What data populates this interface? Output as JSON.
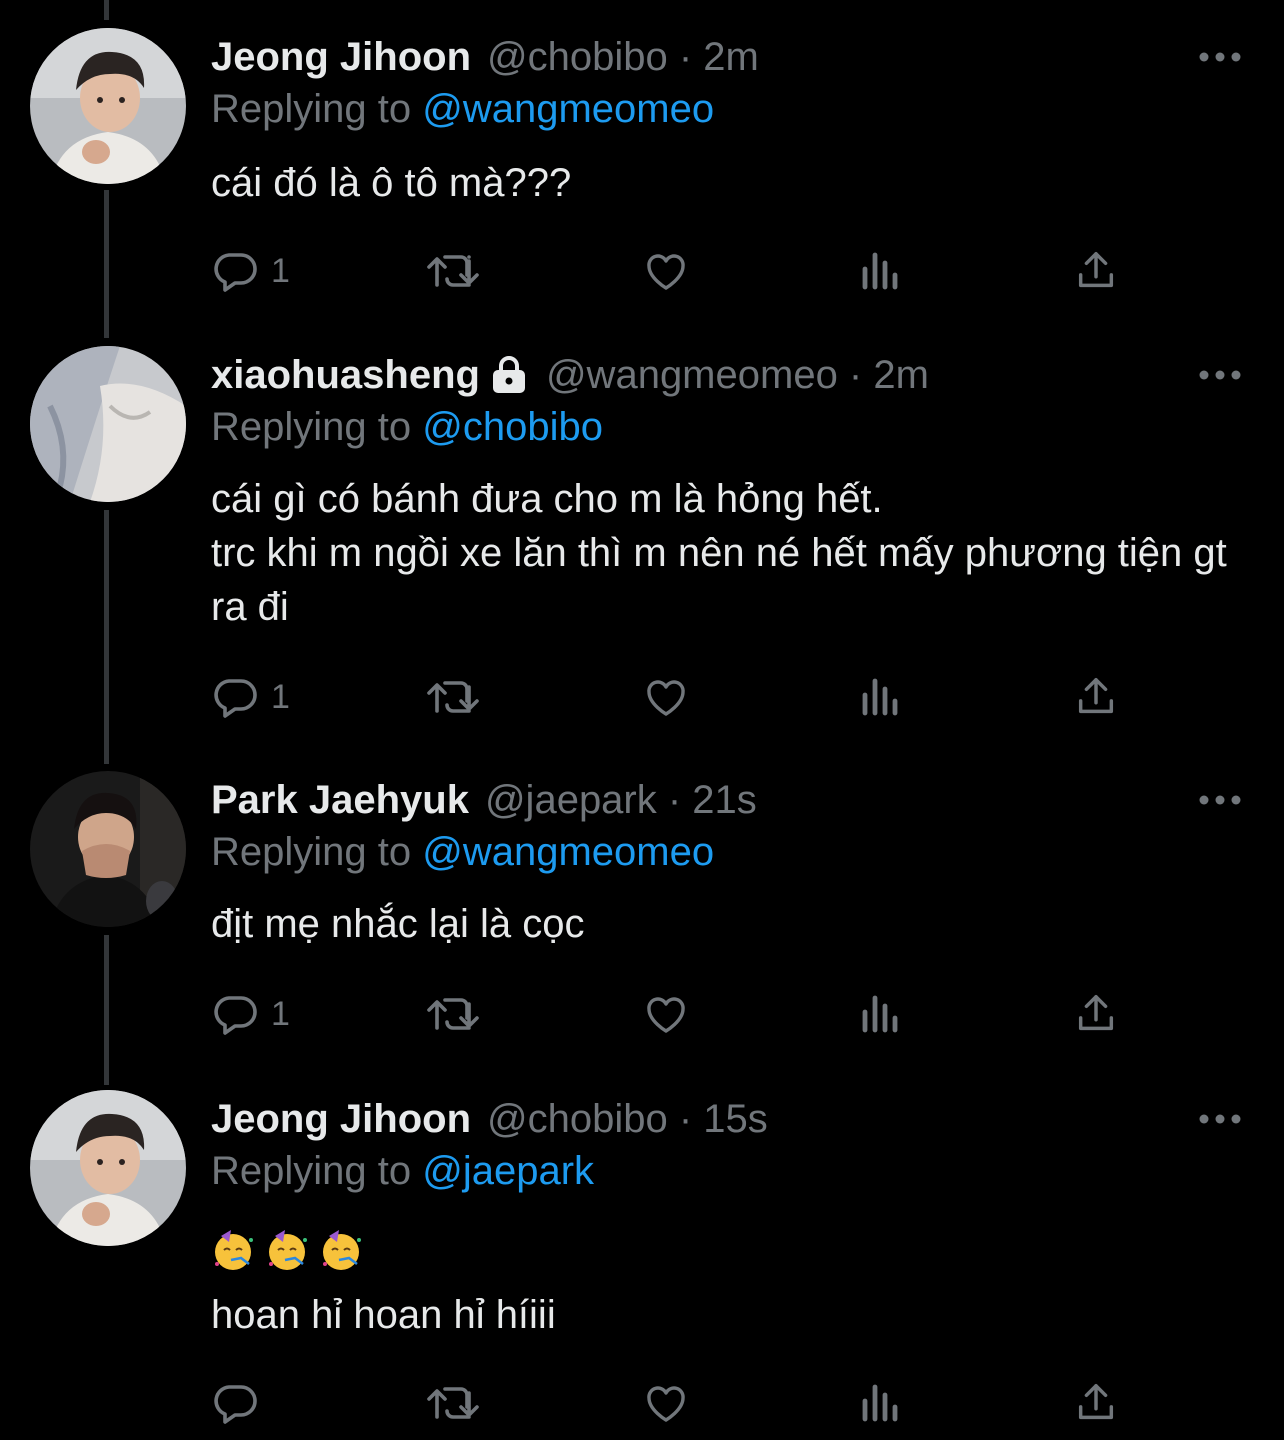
{
  "tweets": [
    {
      "name": "Jeong Jihoon",
      "meta": "@chobibo · 2m",
      "replying_prefix": "Replying to ",
      "replying_to": "@wangmeomeo",
      "text": "cái đó là ô tô mà???",
      "reply_count": "1",
      "avatar": "avatar-jihoon"
    },
    {
      "name": "xiaohuasheng",
      "locked": true,
      "meta": "@wangmeomeo · 2m",
      "replying_prefix": "Replying to ",
      "replying_to": "@chobibo",
      "text": "cái gì có bánh đưa cho m là hỏng hết.\ntrc khi m ngồi xe lăn thì m nên né hết mấy phương tiện gt ra đi",
      "reply_count": "1",
      "avatar": "avatar-xiaohuasheng"
    },
    {
      "name": "Park Jaehyuk",
      "meta": "@jaepark · 21s",
      "replying_prefix": "Replying to ",
      "replying_to": "@wangmeomeo",
      "text": "địt mẹ nhắc lại là cọc",
      "reply_count": "1",
      "avatar": "avatar-jaehyuk"
    },
    {
      "name": "Jeong Jihoon",
      "meta": "@chobibo · 15s",
      "replying_prefix": "Replying to ",
      "replying_to": "@jaepark",
      "emojis": [
        "🥳",
        "🥳",
        "🥳"
      ],
      "text": "hoan hỉ hoan hỉ híiii",
      "reply_count": "",
      "avatar": "avatar-jihoon"
    }
  ],
  "icons": {
    "reply": "reply-icon",
    "retweet": "retweet-icon",
    "like": "like-icon",
    "views": "views-icon",
    "share": "share-icon",
    "more": "more-icon",
    "lock": "lock-icon"
  },
  "colors": {
    "background": "#000000",
    "text": "#e7e9ea",
    "secondary": "#71767b",
    "mention": "#1d9bf0",
    "thread_line": "#333639"
  }
}
